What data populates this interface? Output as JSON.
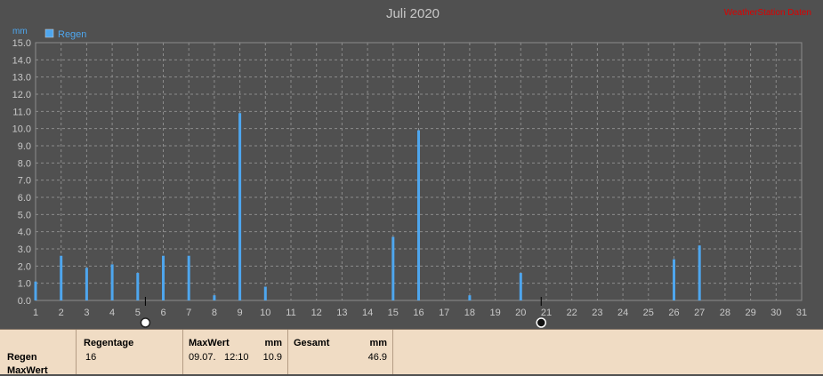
{
  "chart_data": {
    "type": "bar",
    "title": "Juli 2020",
    "unit": "mm",
    "legend": "Regen",
    "legend_placement": "top-left",
    "watermark": "WeatherStation Daten",
    "x": [
      1,
      2,
      3,
      4,
      5,
      6,
      7,
      8,
      9,
      10,
      15,
      16,
      18,
      20,
      26,
      27
    ],
    "values": [
      1.1,
      2.6,
      1.9,
      2.1,
      1.6,
      2.6,
      2.6,
      0.3,
      10.9,
      0.8,
      3.7,
      9.9,
      0.3,
      1.6,
      2.4,
      3.2
    ],
    "xlim": [
      1,
      31
    ],
    "ylim": [
      0,
      15
    ],
    "ytick_step": 1.0,
    "grid": true,
    "series_color": "#4ea6ee",
    "markers": [
      {
        "type": "full-moon",
        "x": 5.3
      },
      {
        "type": "new-moon",
        "x": 20.8
      }
    ]
  },
  "stats": {
    "row_labels": [
      "Regen",
      "MaxWert"
    ],
    "regentage": {
      "label": "Regentage",
      "value": "16"
    },
    "maxwert": {
      "label": "MaxWert",
      "unit": "mm",
      "date": "09.07.",
      "time": "12:10",
      "value": "10.9"
    },
    "gesamt": {
      "label": "Gesamt",
      "unit": "mm",
      "value": "46.9"
    }
  }
}
